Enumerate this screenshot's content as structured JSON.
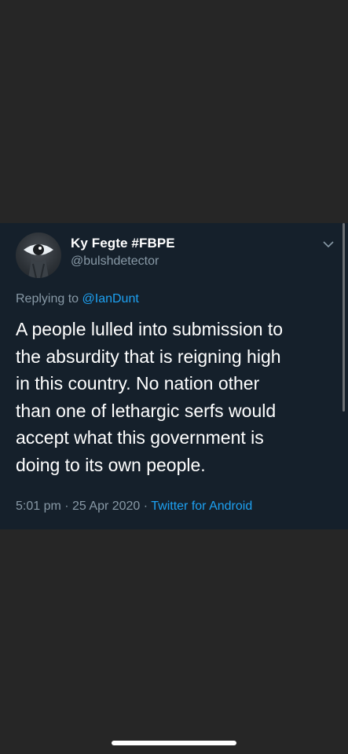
{
  "tweet": {
    "display_name": "Ky Fegte #FBPE",
    "handle": "@bulshdetector",
    "replying_prefix": "Replying to ",
    "replying_to": "@IanDunt",
    "text": "A people lulled into submission to\nthe absurdity that is reigning high\nin this country. No nation other\nthan one of lethargic serfs would\naccept what this government is\ndoing to its own people.",
    "time": "5:01 pm",
    "separator": " · ",
    "date": "25 Apr 2020",
    "client": "Twitter for Android"
  },
  "colors": {
    "background": "#262626",
    "card": "#15202b",
    "link": "#1da1f2",
    "secondary_text": "#8899a6"
  },
  "icons": {
    "avatar": "eye-avatar",
    "chevron": "chevron-down-icon"
  }
}
